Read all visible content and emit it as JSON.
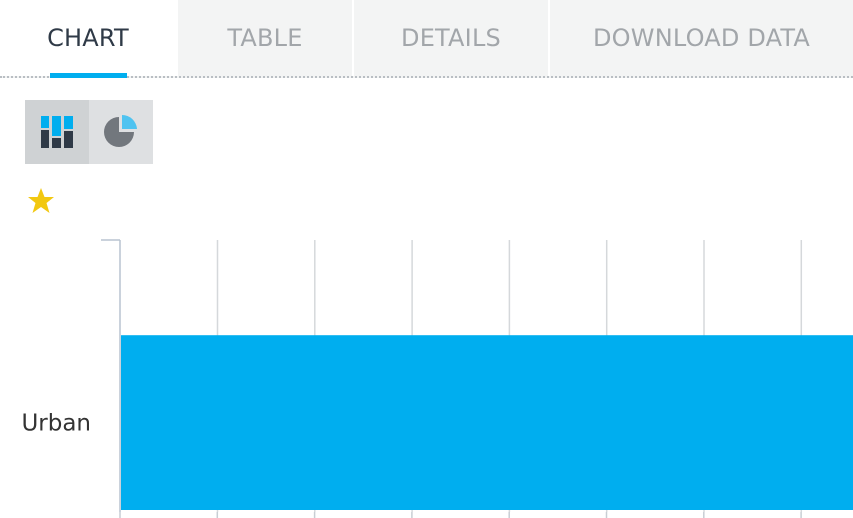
{
  "tabs": [
    {
      "label": "CHART",
      "active": true
    },
    {
      "label": "TABLE",
      "active": false
    },
    {
      "label": "DETAILS",
      "active": false
    },
    {
      "label": "DOWNLOAD DATA",
      "active": false
    }
  ],
  "view_toggle": {
    "bar_icon": "bar-chart-icon",
    "pie_icon": "pie-chart-icon",
    "selected": "bar"
  },
  "favorite_icon": "star-icon",
  "colors": {
    "accent": "#00aeef",
    "star": "#f2c811",
    "grid": "#d5d8db",
    "icon_dark": "#2f3a47",
    "icon_gray": "#72777d"
  },
  "chart_data": {
    "type": "bar",
    "orientation": "horizontal",
    "categories": [
      "Urban"
    ],
    "series": [
      {
        "values": [
          100
        ]
      }
    ],
    "xlim": [
      0,
      100
    ],
    "grid": true,
    "tick_labels_visible": false
  }
}
